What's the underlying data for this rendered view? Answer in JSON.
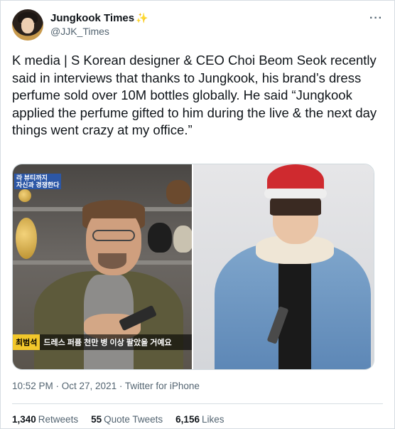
{
  "author": {
    "display_name": "Jungkook Times",
    "emoji_icon": "sparkle-icon",
    "handle": "@JJK_Times"
  },
  "tweet": {
    "text": "K media | S Korean designer & CEO Choi Beom Seok recently said in interviews that thanks to Jungkook, his brand’s dress perfume sold over 10M bottles globally. He said “Jungkook applied the perfume gifted to him during the live & the next day things went crazy at my office.”"
  },
  "media": {
    "left_caption_top": "라 뷰티까지\n자신과 경쟁한다",
    "left_caption_name": "최범석",
    "left_caption_text": "드레스 퍼퓸 천만 병 이상 팔았을 거예요"
  },
  "meta": {
    "timestamp": "10:52 PM · Oct 27, 2021 · Twitter for iPhone"
  },
  "stats": {
    "retweets_count": "1,340",
    "retweets_label": "Retweets",
    "quotes_count": "55",
    "quotes_label": "Quote Tweets",
    "likes_count": "6,156",
    "likes_label": "Likes"
  },
  "colors": {
    "text": "#0f1419",
    "secondary": "#536471",
    "border": "#d6dde2",
    "emoji": "#f4b32b"
  }
}
